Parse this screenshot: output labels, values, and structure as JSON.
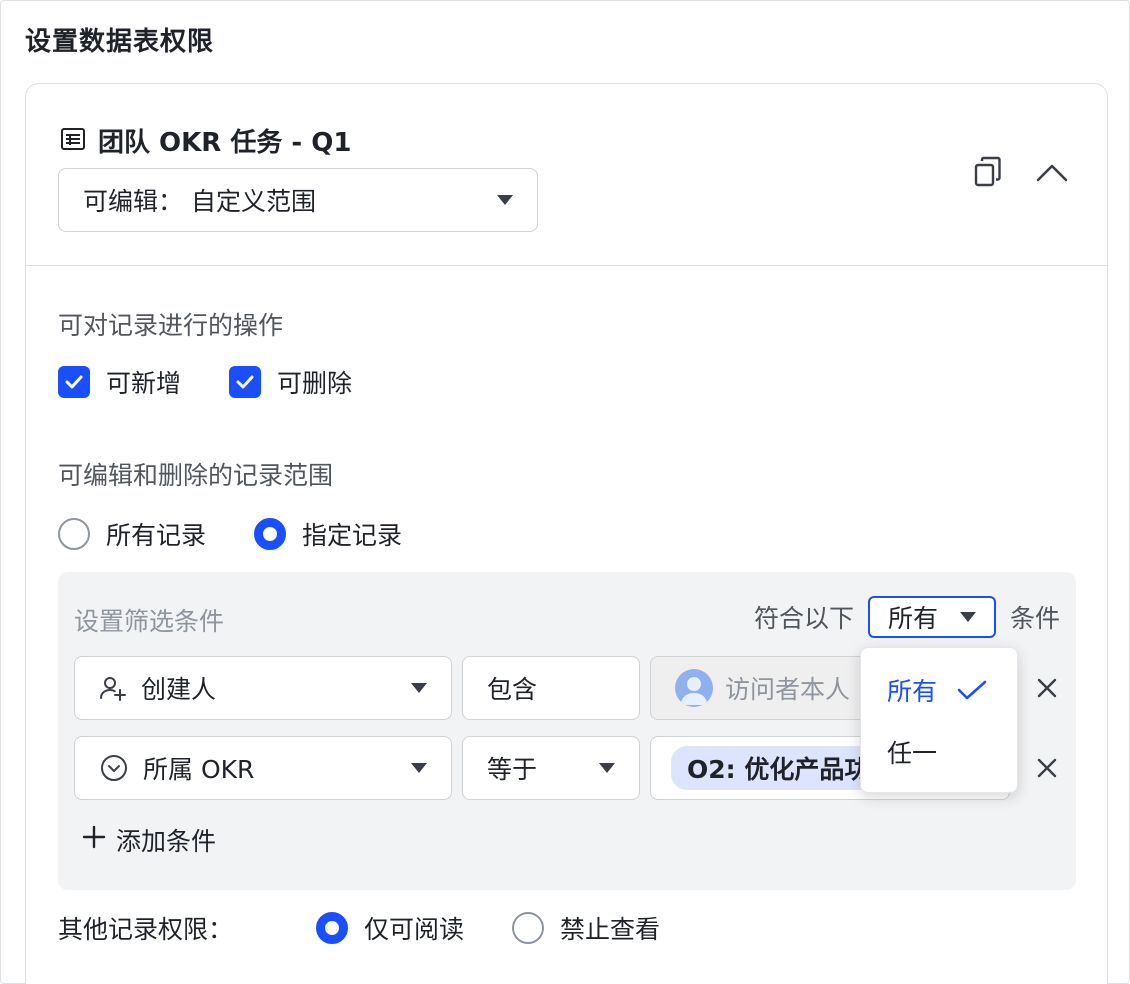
{
  "page": {
    "title": "设置数据表权限"
  },
  "table": {
    "name": "团队 OKR 任务 - Q1",
    "permission_select": "可编辑： 自定义范围",
    "icons": [
      "table-icon",
      "copy-icon",
      "chevron-up-icon"
    ]
  },
  "operations": {
    "label": "可对记录进行的操作",
    "items": [
      {
        "label": "可新增",
        "checked": true
      },
      {
        "label": "可删除",
        "checked": true
      }
    ]
  },
  "scope": {
    "label": "可编辑和删除的记录范围",
    "options": [
      {
        "label": "所有记录",
        "selected": false
      },
      {
        "label": "指定记录",
        "selected": true
      }
    ]
  },
  "filter": {
    "title": "设置筛选条件",
    "match_prefix": "符合以下",
    "match_value": "所有",
    "match_suffix": "条件",
    "conditions": [
      {
        "field": "创建人",
        "field_icon": "user-add-icon",
        "operator": "包含",
        "value": "访问者本人",
        "value_icon": "avatar-icon"
      },
      {
        "field": "所属 OKR",
        "field_icon": "circle-chevron-icon",
        "operator": "等于",
        "value": "O2: 优化产品功"
      }
    ],
    "add_label": "添加条件"
  },
  "match_dropdown": {
    "options": [
      {
        "label": "所有",
        "selected": true
      },
      {
        "label": "任一",
        "selected": false
      }
    ]
  },
  "other_records": {
    "label": "其他记录权限：",
    "options": [
      {
        "label": "仅可阅读",
        "selected": true
      },
      {
        "label": "禁止查看",
        "selected": false
      }
    ]
  },
  "colors": {
    "accent": "#1a4fff",
    "border": "#dee0e3",
    "panel": "#f2f3f5",
    "tag": "#dce5fd"
  }
}
